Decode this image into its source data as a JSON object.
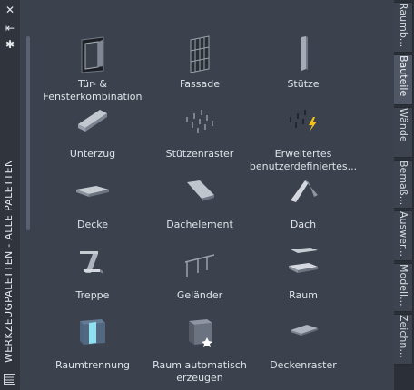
{
  "palette": {
    "title": "WERKZEUGPALETTEN - ALLE PALETTEN"
  },
  "tools": [
    {
      "label": "Tür- & Fensterkombination",
      "icon": "door-window-assembly-icon"
    },
    {
      "label": "Fassade",
      "icon": "curtain-wall-icon"
    },
    {
      "label": "Stütze",
      "icon": "column-icon"
    },
    {
      "label": "Unterzug",
      "icon": "beam-icon"
    },
    {
      "label": "Stützenraster",
      "icon": "column-grid-icon"
    },
    {
      "label": "Erweitertes benutzerdefiniertes...",
      "icon": "custom-grid-icon"
    },
    {
      "label": "Decke",
      "icon": "slab-icon"
    },
    {
      "label": "Dachelement",
      "icon": "roof-slab-icon"
    },
    {
      "label": "Dach",
      "icon": "roof-icon"
    },
    {
      "label": "Treppe",
      "icon": "stair-icon"
    },
    {
      "label": "Geländer",
      "icon": "railing-icon"
    },
    {
      "label": "Raum",
      "icon": "space-icon"
    },
    {
      "label": "Raumtrennung",
      "icon": "space-separator-icon"
    },
    {
      "label": "Raum automatisch erzeugen",
      "icon": "space-auto-generate-icon"
    },
    {
      "label": "Deckenraster",
      "icon": "ceiling-grid-icon"
    }
  ],
  "tabs": [
    {
      "label": "Raumb..."
    },
    {
      "label": "Bauteile"
    },
    {
      "label": "Wände"
    },
    {
      "label": "Bemaß..."
    },
    {
      "label": "Auswer..."
    },
    {
      "label": "Modell..."
    },
    {
      "label": "Zeichn..."
    }
  ]
}
